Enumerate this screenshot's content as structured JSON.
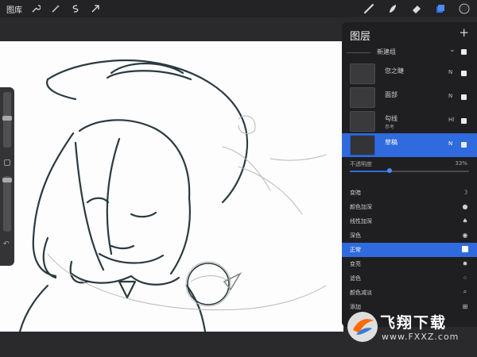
{
  "topbar": {
    "gallery_label": "图库",
    "left_tools": [
      "wrench-icon",
      "magic-wand-icon",
      "selection-icon",
      "transform-arrow-icon"
    ],
    "right_tools": [
      "brush-icon",
      "smudge-icon",
      "eraser-icon",
      "layers-icon",
      "color-icon"
    ]
  },
  "sidebar": {
    "brush_size_slider": "brush-size",
    "opacity_slider": "brush-opacity"
  },
  "layers_panel": {
    "title": "图层",
    "add_label": "+",
    "group": {
      "label": "新建组"
    },
    "layers": [
      {
        "name": "您之睫",
        "sub": "",
        "mode": "N",
        "visible": true,
        "active": false
      },
      {
        "name": "面部",
        "sub": "",
        "mode": "N",
        "visible": true,
        "active": false
      },
      {
        "name": "勾线",
        "sub": "参考",
        "mode": "Hl",
        "visible": true,
        "active": false
      },
      {
        "name": "草稿",
        "sub": "",
        "mode": "N",
        "visible": true,
        "active": true
      }
    ],
    "opacity": {
      "label": "不透明度",
      "value_text": "33%",
      "value": 0.33
    },
    "blend_modes": [
      {
        "name": "变暗",
        "icon": "moon-icon",
        "selected": false
      },
      {
        "name": "颜色加深",
        "icon": "drop-icon",
        "selected": false
      },
      {
        "name": "线性加深",
        "icon": "flame-icon",
        "selected": false
      },
      {
        "name": "深色",
        "icon": "dot-icon",
        "selected": false
      },
      {
        "name": "正常",
        "icon": "box-icon",
        "selected": true
      },
      {
        "name": "变亮",
        "icon": "sun-icon",
        "selected": false
      },
      {
        "name": "滤色",
        "icon": "dots-icon",
        "selected": false
      },
      {
        "name": "颜色减淡",
        "icon": "search-icon",
        "selected": false
      },
      {
        "name": "添加",
        "icon": "plus-box-icon",
        "selected": false
      }
    ]
  },
  "watermark": {
    "brand": "飞翔下载",
    "url": "www.FXXZ.com"
  },
  "colors": {
    "accent": "#2f6bde",
    "panel_bg": "#1f1f21",
    "topbar_bg": "#232325",
    "color_swatch": "#2b2b2e"
  }
}
